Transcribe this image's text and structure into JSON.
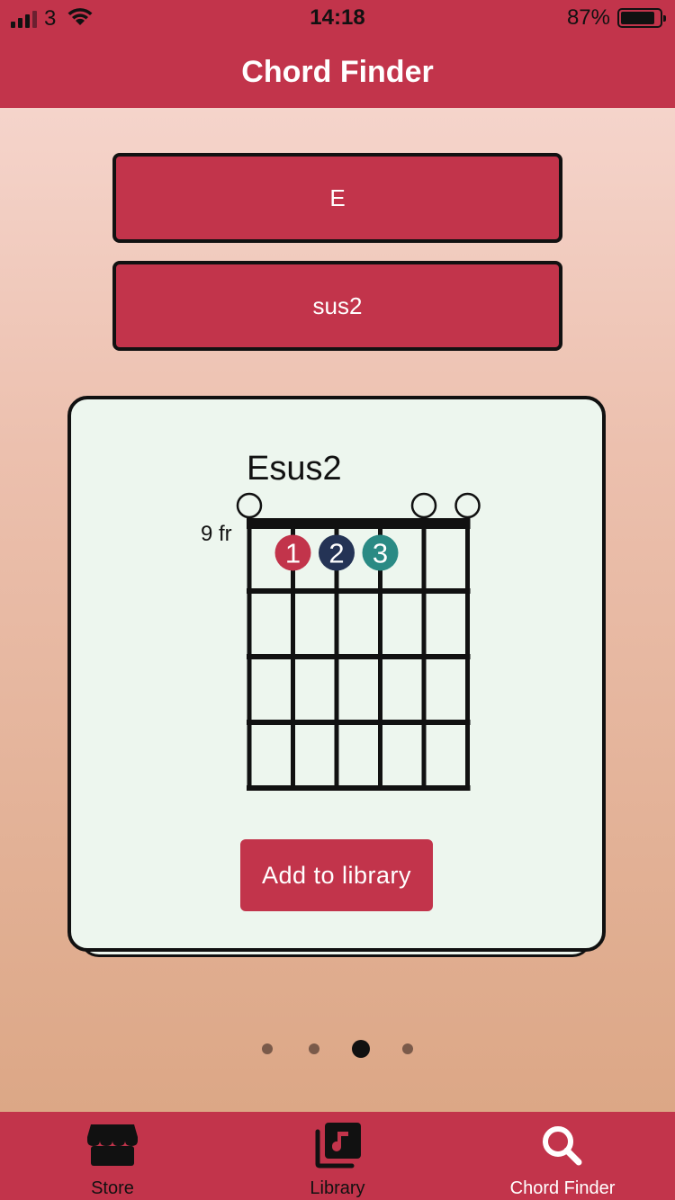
{
  "status_bar": {
    "carrier": "3",
    "time": "14:18",
    "battery": "87%",
    "battery_level": 0.87
  },
  "nav": {
    "title": "Chord Finder"
  },
  "pickers": {
    "root": "E",
    "quality": "sus2"
  },
  "chord": {
    "name": "Esus2",
    "start_fret_label": "9 fr",
    "open_markers": [
      "o",
      "",
      "",
      "",
      "o",
      "o"
    ],
    "fingers": [
      {
        "string": 2,
        "fret": 1,
        "label": "1",
        "color": "#c2344b"
      },
      {
        "string": 3,
        "fret": 1,
        "label": "2",
        "color": "#243355"
      },
      {
        "string": 4,
        "fret": 1,
        "label": "3",
        "color": "#2a8a84"
      }
    ],
    "add_button": "Add to library"
  },
  "pagination": {
    "count": 4,
    "active": 3
  },
  "tabs": [
    {
      "label": "Store",
      "icon": "store-icon",
      "active": false
    },
    {
      "label": "Library",
      "icon": "music-library-icon",
      "active": false
    },
    {
      "label": "Chord Finder",
      "icon": "search-icon",
      "active": true
    }
  ],
  "colors": {
    "accent": "#c2344b",
    "card": "#edf6ee",
    "finger_1": "#c2344b",
    "finger_2": "#243355",
    "finger_3": "#2a8a84"
  }
}
